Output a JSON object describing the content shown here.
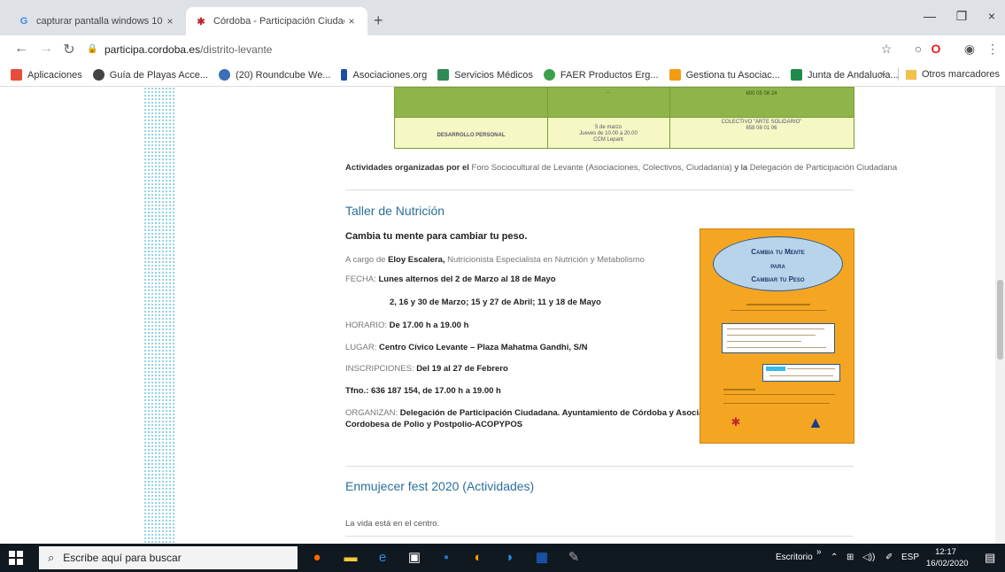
{
  "browser": {
    "tabs": [
      {
        "favicon": "google-g-icon",
        "title": "capturar pantalla windows 10 - ",
        "close": "×"
      },
      {
        "favicon": "cordoba-crest-icon",
        "title": "Córdoba - Participación Ciudada",
        "close": "×"
      }
    ],
    "new_tab": "+",
    "window_controls": {
      "minimize": "—",
      "maximize": "❐",
      "close": "×"
    },
    "url": {
      "domain": "participa.cordoba.es",
      "path": "/distrito-levante"
    },
    "bookmarks": [
      {
        "label": "Aplicaciones",
        "color": "#e74c3c"
      },
      {
        "label": "Guía de Playas Acce...",
        "color": "#444444"
      },
      {
        "label": "(20) Roundcube We...",
        "color": "#3b6fb6"
      },
      {
        "label": "Asociaciones.org",
        "color": "#1f4fa0"
      },
      {
        "label": "Servicios Médicos",
        "color": "#2e8b57"
      },
      {
        "label": "FAER Productos Erg...",
        "color": "#3aa14a"
      },
      {
        "label": "Gestiona tu Asociac...",
        "color": "#f39c12"
      },
      {
        "label": "Junta de Andalucía...",
        "color": "#1e8b4a"
      }
    ],
    "bookmarks_more": "»",
    "other_bookmarks": "Otros marcadores"
  },
  "schedule_fragment": {
    "row1_col2": "...",
    "row1_col3": "600 05 08 24",
    "row2_col1": "DESARROLLO PERSONAL",
    "row2_col2_line1": "5 de marzo",
    "row2_col2_line2": "Jueves de 10.00 a 20.00",
    "row2_col2_line3": "CCM Lepant",
    "row2_col3_line1": "COLECTIVO \"ARTE SOLIDARIO\"",
    "row2_col3_line2": "658 08 01 06"
  },
  "credits": {
    "prefix": "Actividades organizadas por el",
    "foro": "Foro Sociocultural de Levante (Asociaciones, Colectivos, Ciudadanía)",
    "middle": "y la",
    "delegacion": "Delegación de Participación Ciudadana"
  },
  "nutrition": {
    "heading": "Taller de Nutrición",
    "subtitle": "Cambia tu mente para cambiar tu peso.",
    "by_label": "A cargo de",
    "by_name": "Eloy Escalera,",
    "by_desc": "Nutricionista Especialista en Nutrición y Metabolismo",
    "fecha_label": "FECHA:",
    "fecha_value": "Lunes alternos del 2 de Marzo al 18 de Mayo",
    "fecha_dates": "2, 16 y 30 de Marzo; 15 y 27 de Abril; 11 y 18 de Mayo",
    "horario_label": "HORARIO:",
    "horario_value": "De 17.00 h a 19.00 h",
    "lugar_label": "LUGAR:",
    "lugar_value": "Centro Cívico Levante – Plaza Mahatma Gandhi, S/N",
    "inscripciones_label": "INSCRIPCIONES:",
    "inscripciones_value": "Del 19 al 27 de Febrero",
    "tfno": "Tfno.: 636 187 154, de 17.00 h a 19.00 h",
    "organizan_label": "ORGANIZAN:",
    "organizan_value_1": "Delegación de Participación Ciudadana. Ayuntamiento de Córdoba y Asociación",
    "organizan_value_2": "Cordobesa de Polio y Postpolio-ACOPYPOS"
  },
  "poster": {
    "line1": "Cambia tu Mente",
    "line2": "para",
    "line3": "Cambiar tu Peso",
    "bg_color": "#f4a623"
  },
  "enmujecer": {
    "heading": "Enmujecer fest 2020 (Actividades)",
    "subtitle": "La vida está en el centro."
  },
  "taskbar": {
    "search_placeholder": "Escribe aquí para buscar",
    "escritorio": "Escritorio",
    "chevron": "»",
    "lang": "ESP",
    "time": "12:17",
    "date": "16/02/2020"
  }
}
